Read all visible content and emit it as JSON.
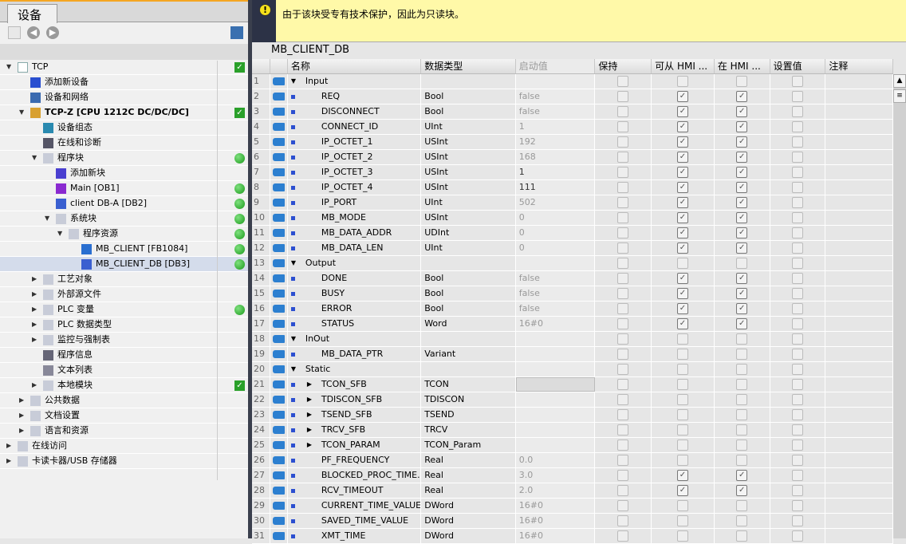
{
  "left": {
    "tab": "设备",
    "tree": [
      {
        "label": "TCP",
        "level": 0,
        "exp": "down",
        "icon": "project-icon",
        "status": "ok"
      },
      {
        "label": "添加新设备",
        "level": 1,
        "icon": "add-device-icon"
      },
      {
        "label": "设备和网络",
        "level": 1,
        "icon": "network-icon"
      },
      {
        "label": "TCP-Z [CPU 1212C DC/DC/DC]",
        "level": 1,
        "exp": "down",
        "icon": "plc-icon",
        "status": "ok",
        "bold": true
      },
      {
        "label": "设备组态",
        "level": 2,
        "icon": "device-config-icon"
      },
      {
        "label": "在线和诊断",
        "level": 2,
        "icon": "diagnostics-icon"
      },
      {
        "label": "程序块",
        "level": 2,
        "exp": "down",
        "icon": "folder-icon",
        "status": "dot"
      },
      {
        "label": "添加新块",
        "level": 3,
        "icon": "add-block-icon"
      },
      {
        "label": "Main [OB1]",
        "level": 3,
        "icon": "ob-icon",
        "status": "dot"
      },
      {
        "label": "client DB-A [DB2]",
        "level": 3,
        "icon": "db-icon",
        "status": "dot"
      },
      {
        "label": "系统块",
        "level": 3,
        "exp": "down",
        "icon": "folder-icon",
        "status": "dot"
      },
      {
        "label": "程序资源",
        "level": 4,
        "exp": "down",
        "icon": "folder-icon",
        "status": "dot"
      },
      {
        "label": "MB_CLIENT [FB1084]",
        "level": 5,
        "icon": "fb-icon",
        "status": "dot"
      },
      {
        "label": "MB_CLIENT_DB [DB3]",
        "level": 5,
        "icon": "db-icon",
        "status": "dot",
        "selected": true
      },
      {
        "label": "工艺对象",
        "level": 2,
        "exp": "right",
        "icon": "folder-icon"
      },
      {
        "label": "外部源文件",
        "level": 2,
        "exp": "right",
        "icon": "folder-icon"
      },
      {
        "label": "PLC 变量",
        "level": 2,
        "exp": "right",
        "icon": "folder-icon",
        "status": "dot"
      },
      {
        "label": "PLC 数据类型",
        "level": 2,
        "exp": "right",
        "icon": "folder-icon"
      },
      {
        "label": "监控与强制表",
        "level": 2,
        "exp": "right",
        "icon": "folder-icon"
      },
      {
        "label": "程序信息",
        "level": 2,
        "icon": "info-icon"
      },
      {
        "label": "文本列表",
        "level": 2,
        "icon": "text-list-icon"
      },
      {
        "label": "本地模块",
        "level": 2,
        "exp": "right",
        "icon": "folder-icon",
        "status": "ok"
      },
      {
        "label": "公共数据",
        "level": 1,
        "exp": "right",
        "icon": "folder-icon"
      },
      {
        "label": "文档设置",
        "level": 1,
        "exp": "right",
        "icon": "folder-icon"
      },
      {
        "label": "语言和资源",
        "level": 1,
        "exp": "right",
        "icon": "folder-icon"
      },
      {
        "label": "在线访问",
        "level": 0,
        "exp": "right",
        "icon": "folder-icon"
      },
      {
        "label": "卡读卡器/USB 存储器",
        "level": 0,
        "exp": "right",
        "icon": "folder-icon"
      }
    ]
  },
  "warning": "由于该块受专有技术保护，因此为只读块。",
  "db_title": "MB_CLIENT_DB",
  "columns": [
    "",
    "",
    "名称",
    "数据类型",
    "启动值",
    "保持",
    "可从 HMI ...",
    "在 HMI ...",
    "设置值",
    "注释"
  ],
  "rows": [
    [
      "1",
      "Input",
      "",
      "",
      "",
      0,
      "down",
      0,
      0
    ],
    [
      "2",
      "REQ",
      "Bool",
      "false",
      1,
      "",
      1,
      1
    ],
    [
      "3",
      "DISCONNECT",
      "Bool",
      "false",
      1,
      "",
      1,
      1
    ],
    [
      "4",
      "CONNECT_ID",
      "UInt",
      "1",
      1,
      "",
      1,
      1
    ],
    [
      "5",
      "IP_OCTET_1",
      "USInt",
      "192",
      1,
      "",
      1,
      1
    ],
    [
      "6",
      "IP_OCTET_2",
      "USInt",
      "168",
      1,
      "",
      1,
      1
    ],
    [
      "7",
      "IP_OCTET_3",
      "USInt",
      "1",
      1,
      "",
      1,
      1,
      "dark"
    ],
    [
      "8",
      "IP_OCTET_4",
      "USInt",
      "111",
      1,
      "",
      1,
      1,
      "dark"
    ],
    [
      "9",
      "IP_PORT",
      "UInt",
      "502",
      1,
      "",
      1,
      1
    ],
    [
      "10",
      "MB_MODE",
      "USInt",
      "0",
      1,
      "",
      1,
      1
    ],
    [
      "11",
      "MB_DATA_ADDR",
      "UDInt",
      "0",
      1,
      "",
      1,
      1
    ],
    [
      "12",
      "MB_DATA_LEN",
      "UInt",
      "0",
      1,
      "",
      1,
      1
    ],
    [
      "13",
      "Output",
      "",
      "",
      "",
      0,
      "down",
      0,
      0
    ],
    [
      "14",
      "DONE",
      "Bool",
      "false",
      1,
      "",
      1,
      1
    ],
    [
      "15",
      "BUSY",
      "Bool",
      "false",
      1,
      "",
      1,
      1
    ],
    [
      "16",
      "ERROR",
      "Bool",
      "false",
      1,
      "",
      1,
      1
    ],
    [
      "17",
      "STATUS",
      "Word",
      "16#0",
      1,
      "",
      1,
      1
    ],
    [
      "18",
      "InOut",
      "",
      "",
      "",
      0,
      "down",
      0,
      0
    ],
    [
      "19",
      "MB_DATA_PTR",
      "Variant",
      "",
      1,
      "",
      0,
      0
    ],
    [
      "20",
      "Static",
      "",
      "",
      "",
      0,
      "down",
      0,
      0
    ],
    [
      "21",
      "TCON_SFB",
      "TCON",
      "",
      1,
      "right",
      0,
      0
    ],
    [
      "22",
      "TDISCON_SFB",
      "TDISCON",
      "",
      1,
      "right",
      0,
      0
    ],
    [
      "23",
      "TSEND_SFB",
      "TSEND",
      "",
      1,
      "right",
      0,
      0
    ],
    [
      "24",
      "TRCV_SFB",
      "TRCV",
      "",
      1,
      "right",
      0,
      0
    ],
    [
      "25",
      "TCON_PARAM",
      "TCON_Param",
      "",
      1,
      "right",
      0,
      0
    ],
    [
      "26",
      "PF_FREQUENCY",
      "Real",
      "0.0",
      1,
      "",
      0,
      0
    ],
    [
      "27",
      "BLOCKED_PROC_TIME...",
      "Real",
      "3.0",
      1,
      "",
      1,
      1
    ],
    [
      "28",
      "RCV_TIMEOUT",
      "Real",
      "2.0",
      1,
      "",
      1,
      1
    ],
    [
      "29",
      "CURRENT_TIME_VALUE",
      "DWord",
      "16#0",
      1,
      "",
      0,
      0
    ],
    [
      "30",
      "SAVED_TIME_VALUE",
      "DWord",
      "16#0",
      1,
      "",
      0,
      0
    ],
    [
      "31",
      "XMT_TIME",
      "DWord",
      "16#0",
      1,
      "",
      0,
      0
    ]
  ]
}
